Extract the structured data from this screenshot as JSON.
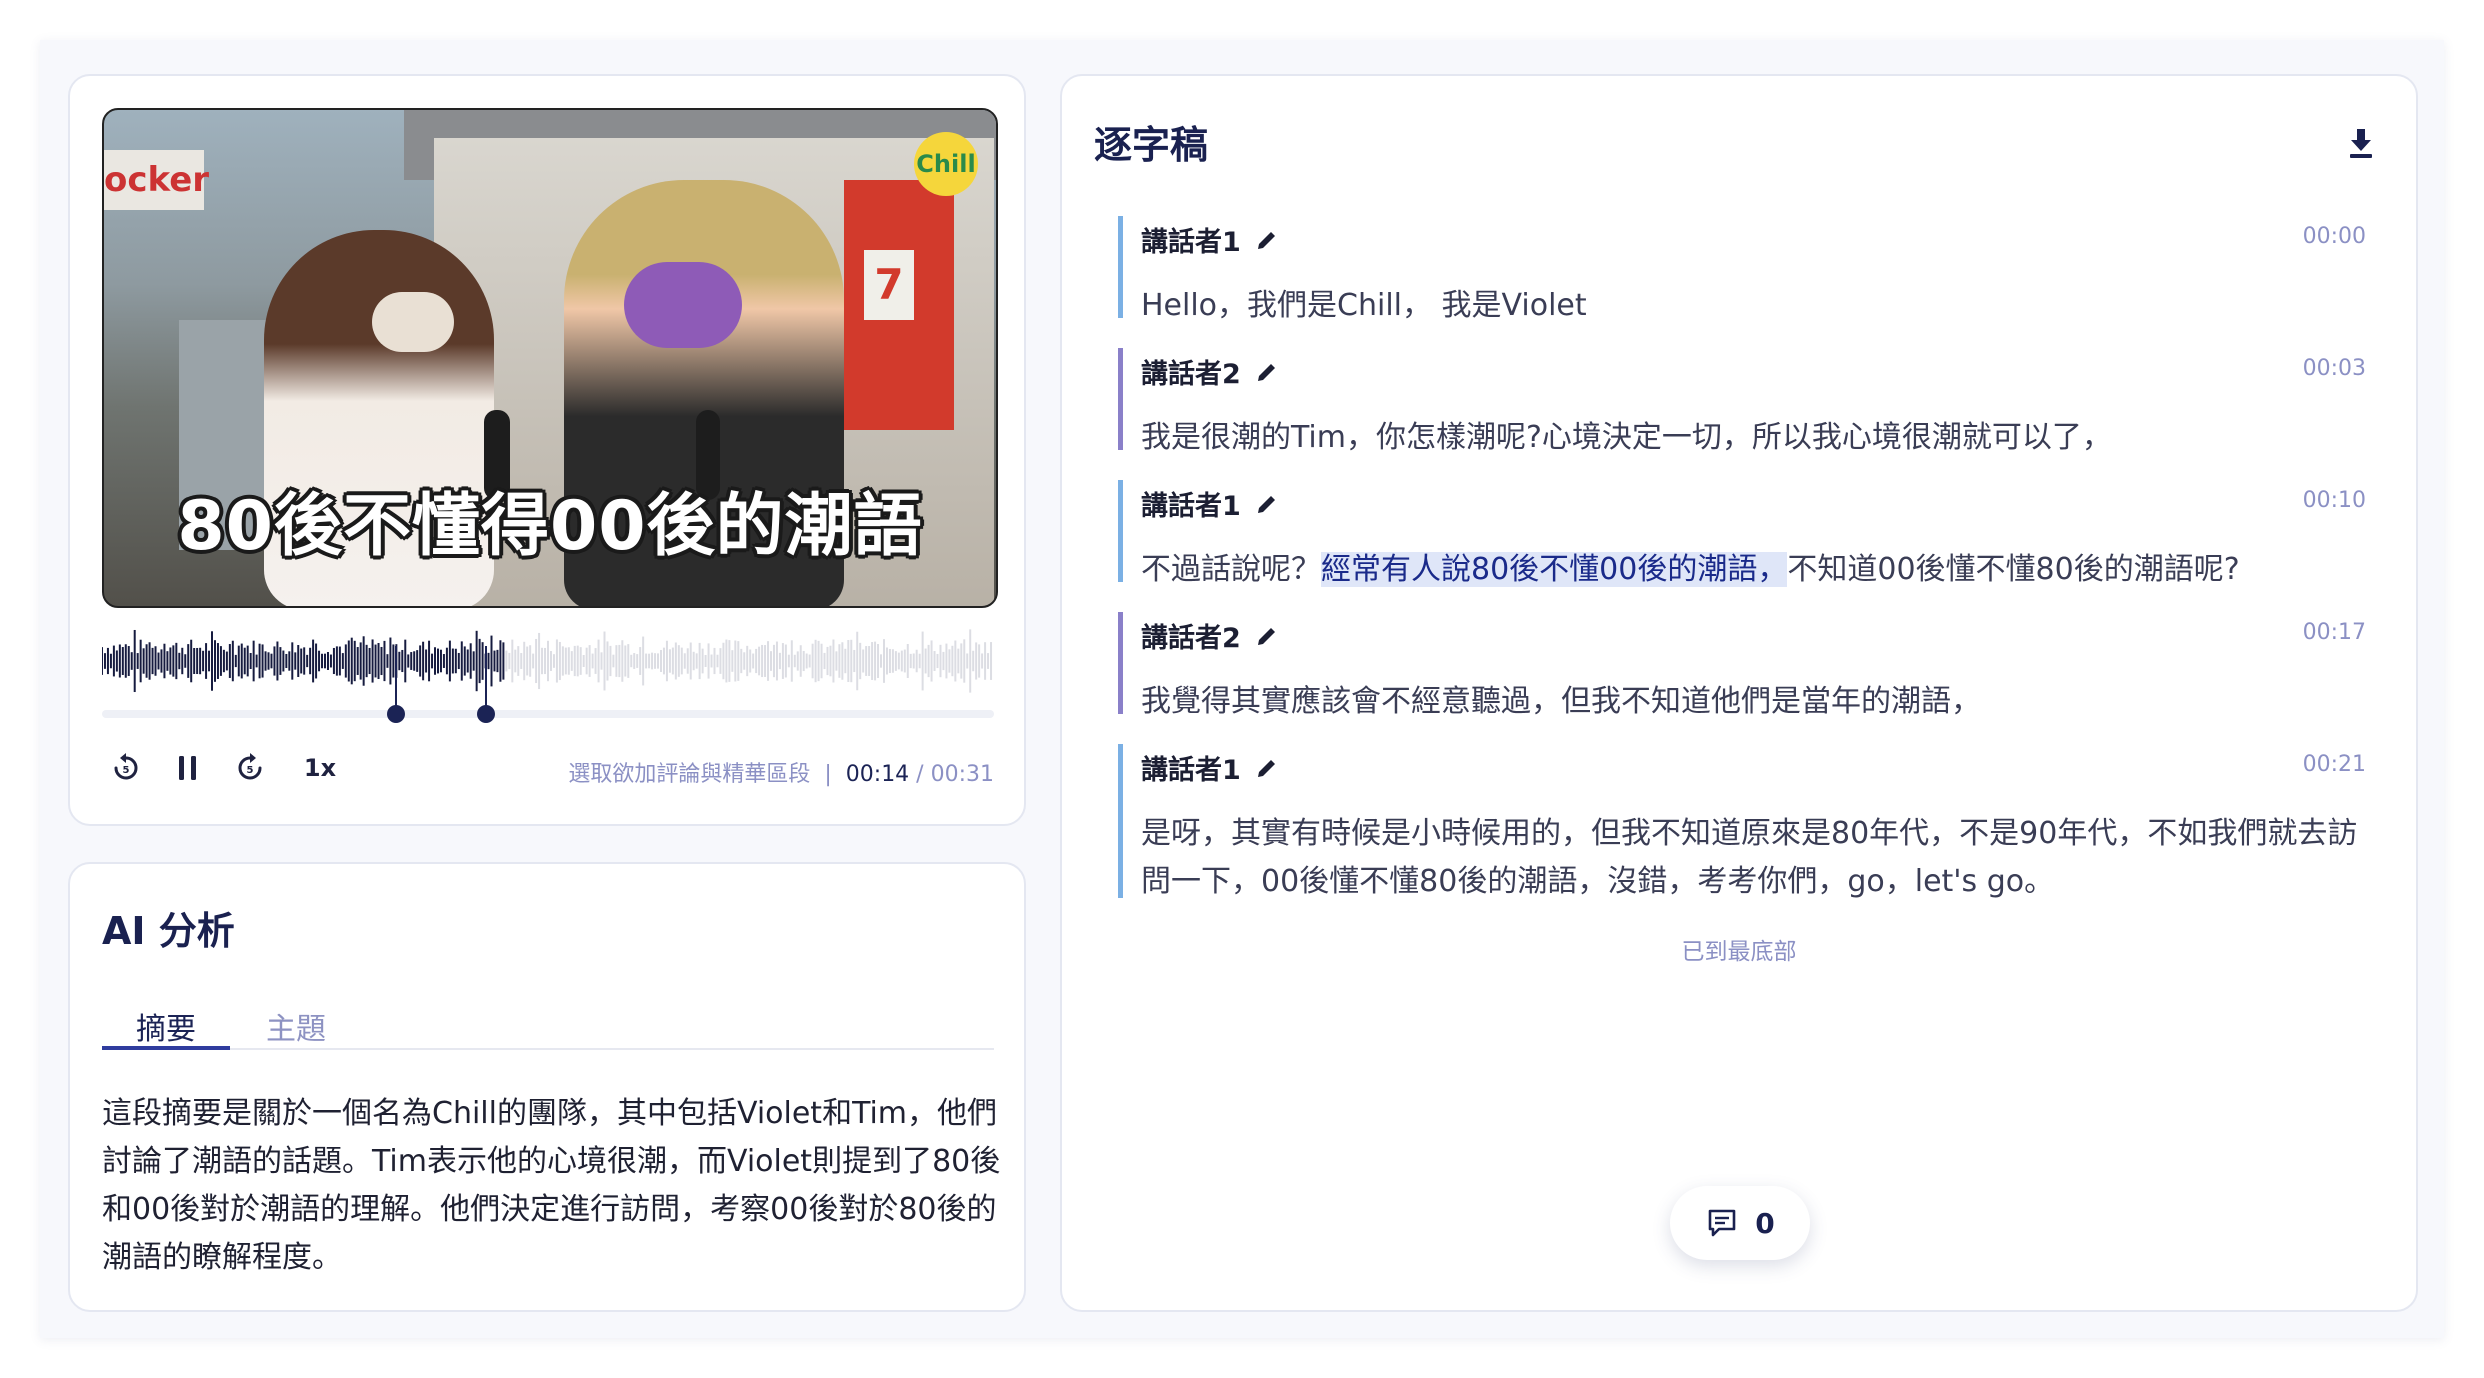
{
  "player": {
    "caption": "80後不懂得00後的潮語",
    "channel_logo": "Chill",
    "speed_label": "1x",
    "range_hint": "選取欲加評論與精華區段",
    "current_time": "00:14",
    "total_time": "00:31",
    "progress": 0.45,
    "selection_start": 0.33,
    "selection_end": 0.43,
    "icons": {
      "back": "replay-icon",
      "pause": "pause-icon",
      "forward": "forward-icon"
    }
  },
  "ai": {
    "title": "AI 分析",
    "tabs": [
      "摘要",
      "主題"
    ],
    "active_tab": "摘要",
    "summary": "這段摘要是關於一個名為Chill的團隊，其中包括Violet和Tim，他們討論了潮語的話題。Tim表示他的心境很潮，而Violet則提到了80後和00後對於潮語的理解。他們決定進行訪問，考察00後對於80後的潮語的瞭解程度。"
  },
  "transcript": {
    "title": "逐字稿",
    "download_icon": "download-icon",
    "segments": [
      {
        "speaker": "講話者1",
        "time": "00:00",
        "text": "Hello，我們是Chill， 我是Violet"
      },
      {
        "speaker": "講話者2",
        "time": "00:03",
        "text": "我是很潮的Tim，你怎樣潮呢?心境決定一切，所以我心境很潮就可以了，"
      },
      {
        "speaker": "講話者1",
        "time": "00:10",
        "text_before": "不過話說呢？",
        "text_highlight": "經常有人說80後不懂00後的潮語，",
        "text_after": "不知道00後懂不懂80後的潮語呢?"
      },
      {
        "speaker": "講話者2",
        "time": "00:17",
        "text": "我覺得其實應該會不經意聽過，但我不知道他們是當年的潮語，"
      },
      {
        "speaker": "講話者1",
        "time": "00:21",
        "text": "是呀，其實有時候是小時候用的，但我不知道原來是80年代，不是90年代，不如我們就去訪問一下，00後懂不懂80後的潮語，沒錯，考考你們，go，let's go。"
      }
    ],
    "end_note": "已到最底部",
    "comment_count": "0"
  },
  "colors": {
    "accent": "#1b2355",
    "muted": "#8b90c4",
    "speaker1_bar": "#7bb0e4",
    "speaker2_bar": "#8a80c9",
    "highlight_bg": "#dfe6f8"
  }
}
